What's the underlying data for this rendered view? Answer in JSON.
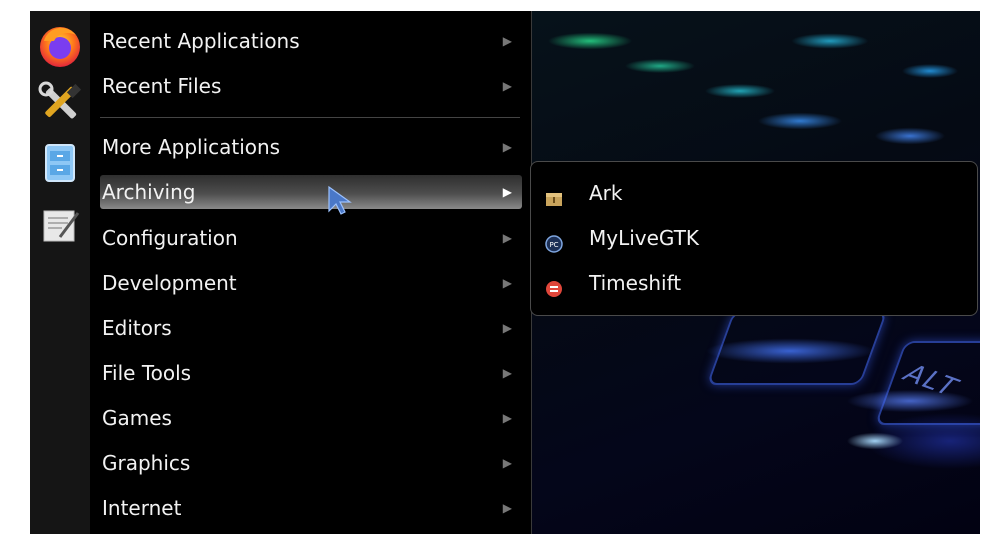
{
  "menu": {
    "items": [
      {
        "label": "Recent Applications",
        "arrow": "▶"
      },
      {
        "label": "Recent Files",
        "arrow": "▶"
      },
      {
        "label": "More Applications",
        "arrow": "▶"
      },
      {
        "label": "Archiving",
        "arrow": "▶"
      },
      {
        "label": "Configuration",
        "arrow": "▶"
      },
      {
        "label": "Development",
        "arrow": "▶"
      },
      {
        "label": "Editors",
        "arrow": "▶"
      },
      {
        "label": "File Tools",
        "arrow": "▶"
      },
      {
        "label": "Games",
        "arrow": "▶"
      },
      {
        "label": "Graphics",
        "arrow": "▶"
      },
      {
        "label": "Internet",
        "arrow": "▶"
      }
    ],
    "active_item": "Archiving"
  },
  "submenu": {
    "items": [
      {
        "label": "Ark",
        "icon": "ark-icon"
      },
      {
        "label": "MyLiveGTK",
        "icon": "mylivegtk-icon"
      },
      {
        "label": "Timeshift",
        "icon": "timeshift-icon"
      }
    ]
  },
  "launcher_icons": [
    "firefox-icon",
    "settings-tools-icon",
    "file-manager-icon",
    "text-editor-icon"
  ],
  "wallpaper_key_label": "ALT"
}
